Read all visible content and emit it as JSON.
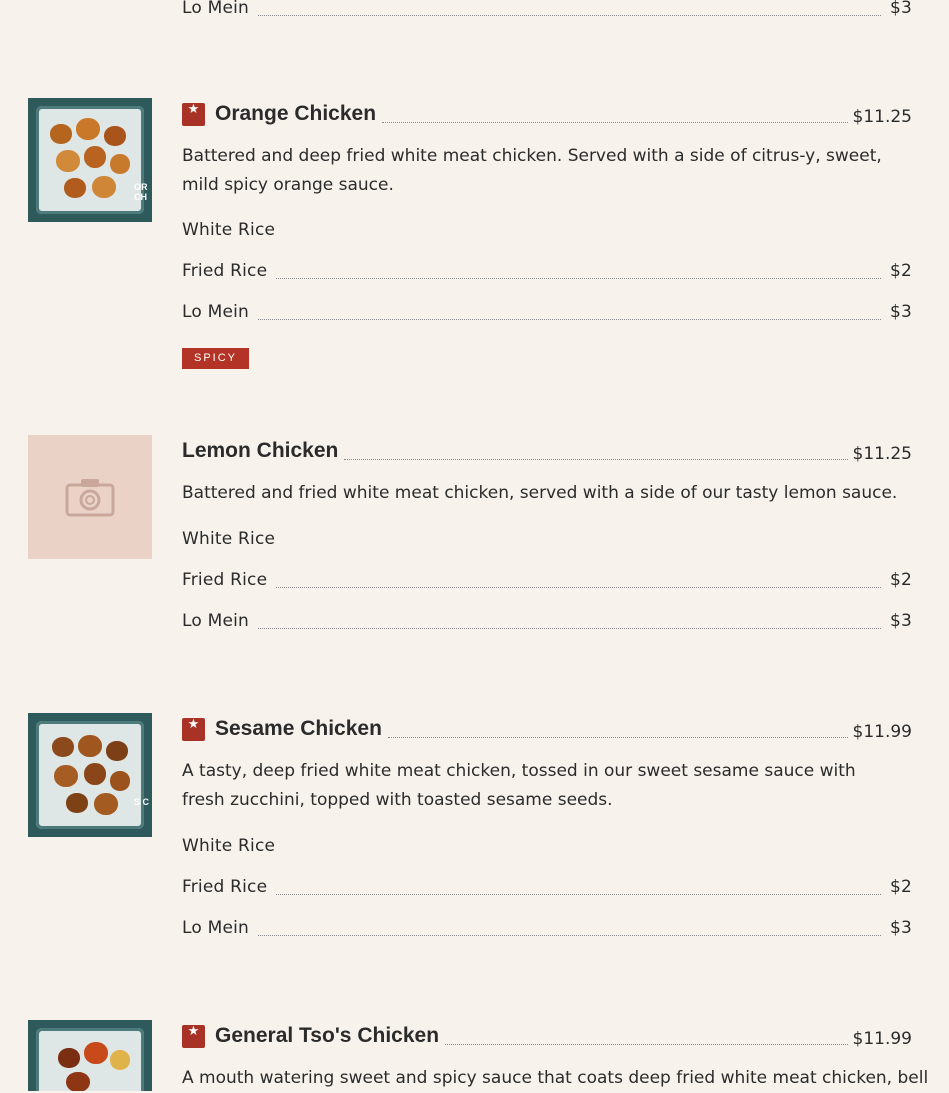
{
  "top_option": {
    "label": "Lo Mein",
    "price": "$3"
  },
  "items": [
    {
      "title": "Orange Chicken",
      "price": "$11.25",
      "description": "Battered and deep fried white meat chicken. Served with a side of citrus-y, sweet, mild spicy orange sauce.",
      "options": [
        {
          "label": "White Rice",
          "price": ""
        },
        {
          "label": "Fried Rice",
          "price": "$2"
        },
        {
          "label": "Lo Mein",
          "price": "$3"
        }
      ],
      "tag": "SPICY",
      "image_text": "OR CH"
    },
    {
      "title": "Lemon Chicken",
      "price": "$11.25",
      "description": "Battered and fried white meat chicken, served with a side of our tasty lemon sauce.",
      "options": [
        {
          "label": "White Rice",
          "price": ""
        },
        {
          "label": "Fried Rice",
          "price": "$2"
        },
        {
          "label": "Lo Mein",
          "price": "$3"
        }
      ]
    },
    {
      "title": "Sesame Chicken",
      "price": "$11.99",
      "description": "A tasty, deep fried white meat chicken, tossed in our sweet sesame sauce with fresh zucchini, topped with toasted sesame seeds.",
      "options": [
        {
          "label": "White Rice",
          "price": ""
        },
        {
          "label": "Fried Rice",
          "price": "$2"
        },
        {
          "label": "Lo Mein",
          "price": "$3"
        }
      ],
      "image_text": "S C"
    },
    {
      "title": "General Tso's Chicken",
      "price": "$11.99",
      "description": "A mouth watering sweet and spicy sauce that coats deep fried white meat chicken, bell"
    }
  ],
  "colors": {
    "background": "#f7f2ec",
    "accent": "#a83226",
    "placeholder": "#ebd2c7"
  },
  "icons": {
    "featured": "star-icon",
    "placeholder": "camera-icon"
  }
}
